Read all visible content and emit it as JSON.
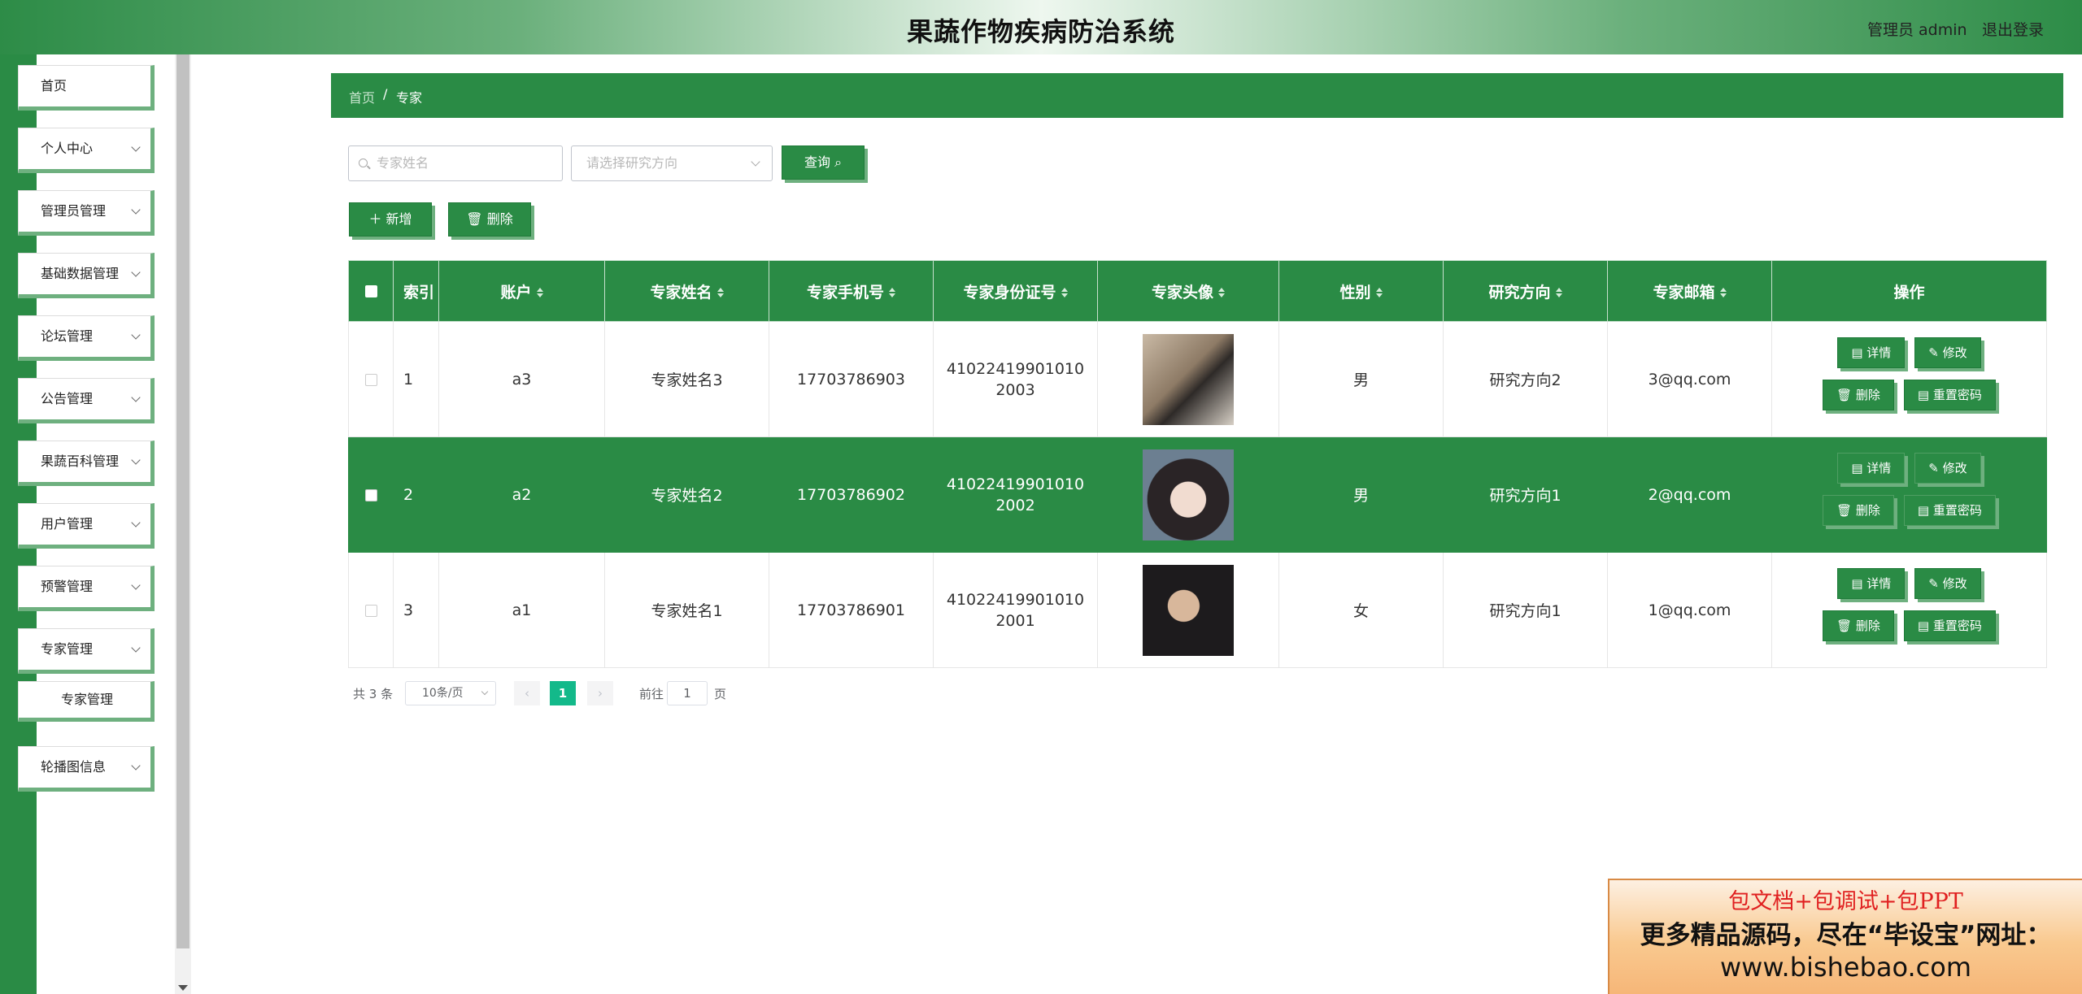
{
  "header": {
    "title": "果蔬作物疾病防治系统",
    "user": "管理员 admin",
    "logout": "退出登录"
  },
  "sidebar": {
    "items": [
      {
        "label": "首页"
      },
      {
        "label": "个人中心"
      },
      {
        "label": "管理员管理"
      },
      {
        "label": "基础数据管理"
      },
      {
        "label": "论坛管理"
      },
      {
        "label": "公告管理"
      },
      {
        "label": "果蔬百科管理"
      },
      {
        "label": "用户管理"
      },
      {
        "label": "预警管理"
      },
      {
        "label": "专家管理"
      },
      {
        "label": "轮播图信息"
      }
    ],
    "sub_item": "专家管理"
  },
  "breadcrumb": {
    "home": "首页",
    "separator": "/",
    "current": "专家"
  },
  "search": {
    "name_placeholder": "专家姓名",
    "direction_placeholder": "请选择研究方向",
    "query_button": "查询"
  },
  "toolbar": {
    "add": "新增",
    "delete": "删除"
  },
  "table": {
    "headers": [
      "索引",
      "账户",
      "专家姓名",
      "专家手机号",
      "专家身份证号",
      "专家头像",
      "性别",
      "研究方向",
      "专家邮箱",
      "操作"
    ],
    "rows": [
      {
        "index": "1",
        "account": "a3",
        "name": "专家姓名3",
        "phone": "17703786903",
        "id_card": "410224199010102003",
        "avatar": "avatar-photo",
        "gender": "男",
        "direction": "研究方向2",
        "email": "3@qq.com"
      },
      {
        "index": "2",
        "account": "a2",
        "name": "专家姓名2",
        "phone": "17703786902",
        "id_card": "410224199010102002",
        "avatar": "avatar-photo",
        "gender": "男",
        "direction": "研究方向1",
        "email": "2@qq.com"
      },
      {
        "index": "3",
        "account": "a1",
        "name": "专家姓名1",
        "phone": "17703786901",
        "id_card": "410224199010102001",
        "avatar": "avatar-photo",
        "gender": "女",
        "direction": "研究方向1",
        "email": "1@qq.com"
      }
    ],
    "actions": {
      "detail": "详情",
      "edit": "修改",
      "delete": "删除",
      "reset": "重置密码"
    },
    "highlight_row": 2
  },
  "pagination": {
    "total": "共 3 条",
    "page_size": "10条/页",
    "current": "1",
    "goto_label": "前往",
    "goto_value": "1",
    "unit": "页"
  },
  "ad": {
    "line1": "包文档+包调试+包PPT",
    "line2": "更多精品源码，尽在“毕设宝”网址：",
    "line3": "www.bishebao.com"
  },
  "colors": {
    "primary": "#2a8b45",
    "shadow": "#6eb07f",
    "pager_active": "#13b98a"
  }
}
